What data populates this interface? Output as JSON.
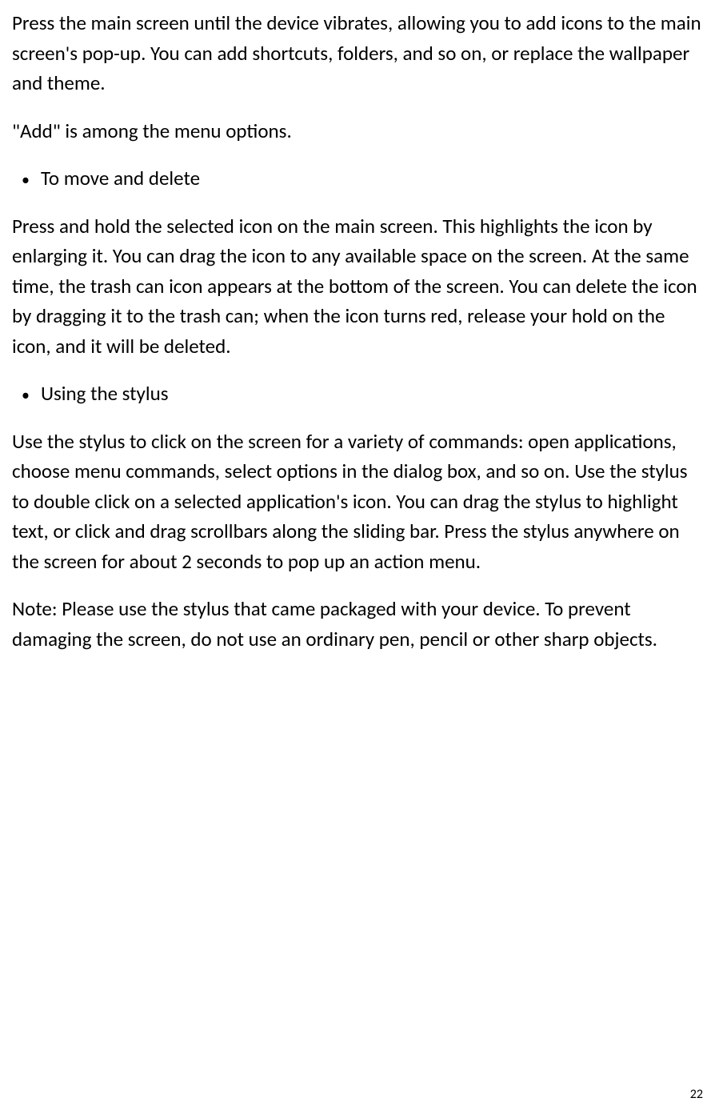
{
  "para1": "Press the main screen until the device vibrates, allowing you to add icons to the main screen's pop-up. You can add shortcuts, folders, and so on, or replace the wallpaper and theme.",
  "para2": "\"Add\" is among the menu options.",
  "bullet1": "To move and delete",
  "para3": "Press and hold the selected icon on the main screen. This highlights the icon by enlarging it. You can drag the icon to any available space on the screen. At the same time, the trash can icon appears at the bottom of the screen. You can delete the icon by dragging it to the trash can; when the icon turns red, release your hold on the icon, and it will be deleted.",
  "bullet2": "Using the stylus",
  "para4": "Use the stylus to click on the screen for a variety of commands: open applications, choose menu commands, select options in the dialog box, and so on. Use the stylus to double click on a selected application's icon. You can drag the stylus to highlight text, or click and drag scrollbars along the sliding bar. Press the stylus anywhere on the screen for about 2 seconds to pop up an action menu.",
  "para5": "Note: Please use the stylus that came packaged with your device. To prevent damaging the screen, do not use an ordinary pen, pencil or other sharp objects.",
  "bullet_char": "•",
  "page_number": "22"
}
